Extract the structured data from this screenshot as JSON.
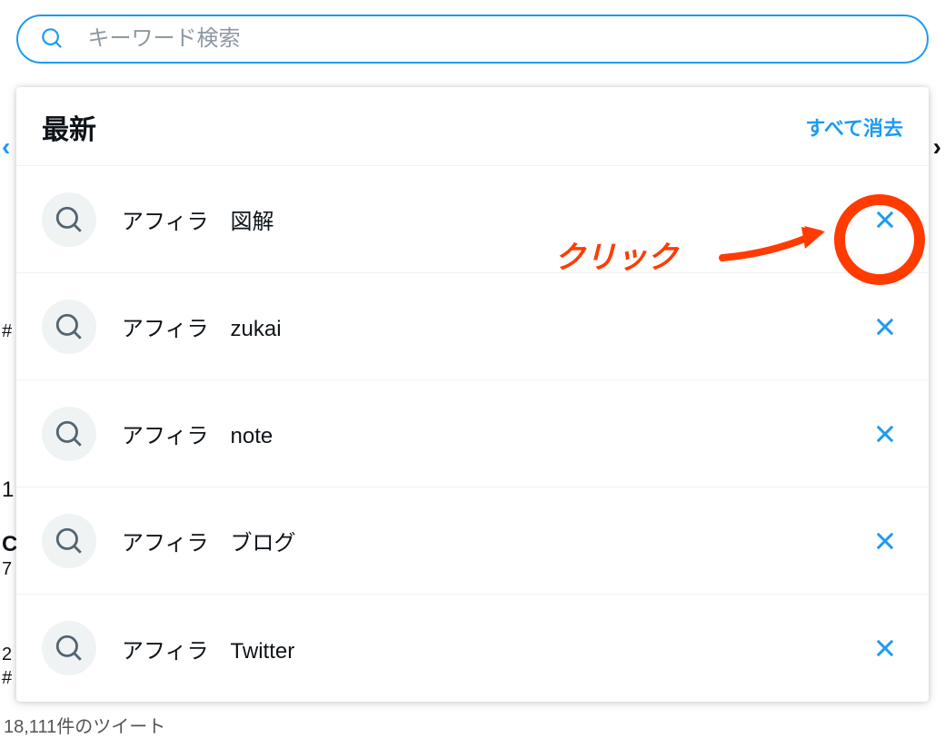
{
  "search": {
    "placeholder": "キーワード検索"
  },
  "dropdown": {
    "title": "最新",
    "clear_all": "すべて消去",
    "items": [
      {
        "label": "アフィラ　図解"
      },
      {
        "label": "アフィラ　zukai"
      },
      {
        "label": "アフィラ　note"
      },
      {
        "label": "アフィラ　ブログ"
      },
      {
        "label": "アフィラ　Twitter"
      }
    ]
  },
  "annotation": {
    "text": "クリック"
  },
  "colors": {
    "accent": "#1d9bf0",
    "annotate": "#ff3b00"
  },
  "ghosts": {
    "left_arrow": "‹",
    "right_paren": "›",
    "hash1": "#",
    "one": "1",
    "c": "C",
    "seven": "7",
    "two": "2",
    "hash2": "#",
    "bottom": "18,111件のツイート"
  }
}
